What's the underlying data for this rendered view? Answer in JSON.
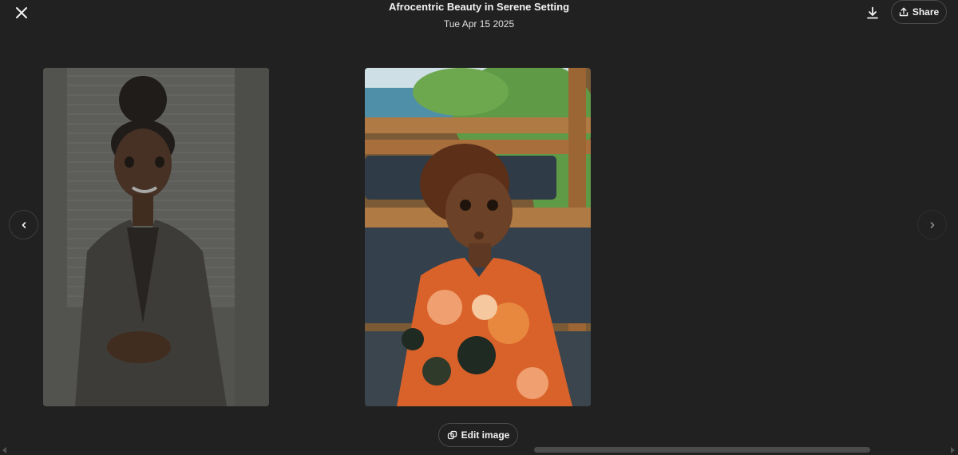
{
  "header": {
    "title": "Afrocentric Beauty in Serene Setting",
    "date": "Tue Apr 15 2025",
    "close_icon": "close-icon",
    "download_icon": "download-icon",
    "share_label": "Share",
    "share_icon": "share-icon"
  },
  "gallery": {
    "images": [
      {
        "name": "previous-image",
        "icon": "thumbnail"
      },
      {
        "name": "current-image",
        "icon": "main-image"
      }
    ],
    "prev_icon": "chevron-left-icon",
    "next_icon": "chevron-right-icon"
  },
  "actions": {
    "edit_label": "Edit image",
    "edit_icon": "edit-image-icon"
  },
  "colors": {
    "background": "#212121",
    "text": "#f2f2f2",
    "border": "#4a4a4a"
  }
}
